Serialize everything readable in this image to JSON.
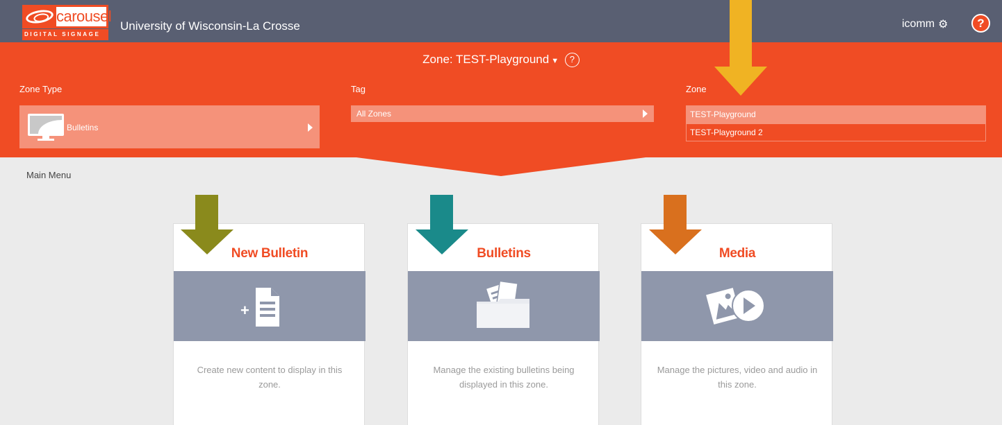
{
  "header": {
    "logo_text": "carousel",
    "logo_tagline": "DIGITAL SIGNAGE",
    "org_name": "University of Wisconsin-La Crosse",
    "username": "icomm",
    "help_label": "?"
  },
  "zone_bar": {
    "title": "Zone: TEST-Playground",
    "help_label": "?",
    "zone_type_label": "Zone Type",
    "zone_type_value": "Bulletins",
    "tag_label": "Tag",
    "tag_value": "All Zones",
    "zone_label": "Zone",
    "zones": [
      "TEST-Playground",
      "TEST-Playground 2"
    ],
    "selected_zone": "TEST-Playground"
  },
  "main_menu_label": "Main Menu",
  "cards": [
    {
      "title": "New Bulletin",
      "description": "Create new content to display in this zone.",
      "icon": "new-document-icon"
    },
    {
      "title": "Bulletins",
      "description": "Manage the existing bulletins being displayed in this zone.",
      "icon": "folder-icon"
    },
    {
      "title": "Media",
      "description": "Manage the pictures, video and audio in this zone.",
      "icon": "media-icon"
    }
  ],
  "colors": {
    "brand_orange": "#f04c24",
    "topbar": "#595f72",
    "card_band": "#8f97ab",
    "annotation_arrows": [
      "#f0b323",
      "#8a8a1c",
      "#1a8a8a",
      "#d9701e"
    ]
  }
}
